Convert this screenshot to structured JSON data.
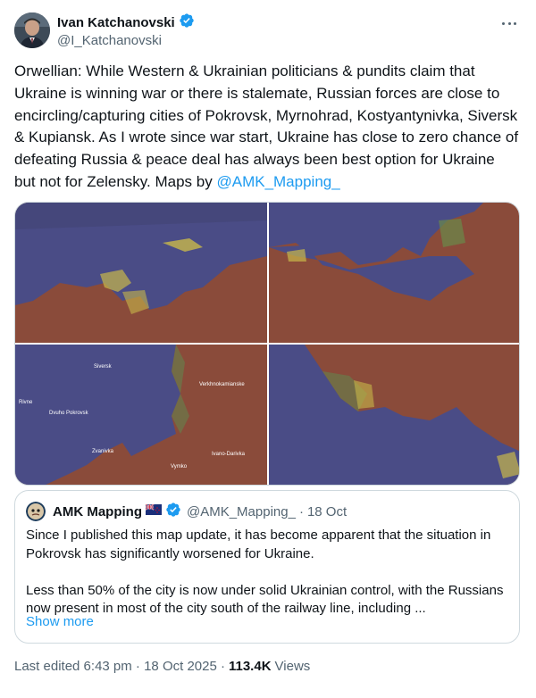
{
  "author": {
    "name": "Ivan Katchanovski",
    "handle": "@I_Katchanovski",
    "verified": true
  },
  "tweet": {
    "text": "Orwellian: While Western & Ukrainian politicians & pundits claim that Ukraine is winning war or there is stalemate, Russian forces are close to encircling/capturing cities of Pokrovsk, Myrnohrad, Kostyantynivka, Siversk & Kupiansk. As I wrote since war start, Ukraine has close to zero chance of defeating Russia & peace deal has always been best option for Ukraine but not for Zelensky. Maps by ",
    "mention": "@AMK_Mapping_"
  },
  "map_labels": {
    "siversk": "Siversk",
    "rivne": "Rivne",
    "dvuho": "Dvuho Pokrovsk",
    "zvanivka": "Zvanivka",
    "verkh": "Verkhnokamianske",
    "ivano": "Ivano-Darivka",
    "vymko": "Vymko"
  },
  "quote": {
    "name": "AMK Mapping",
    "flag": "flag-icon",
    "handle": "@AMK_Mapping_",
    "separator": "·",
    "date": "18 Oct",
    "paragraph1": "Since I published this map update, it has become apparent that the situation in Pokrovsk has significantly worsened for Ukraine.",
    "paragraph2": "Less than 50% of the city is now under solid Ukrainian control, with the Russians now present in most of the city south of the railway line, including ...",
    "show_more": "Show more"
  },
  "footer": {
    "edited": "Last edited 6:43 pm · 18 Oct 2025 ·",
    "views_count": "113.4K",
    "views_label": "Views"
  },
  "colors": {
    "russian_control": "#8a4b3a",
    "ukrainian_control": "#4a4c86",
    "contested": "#c8b84a",
    "link": "#1d9bf0",
    "verified": "#1d9bf0"
  }
}
